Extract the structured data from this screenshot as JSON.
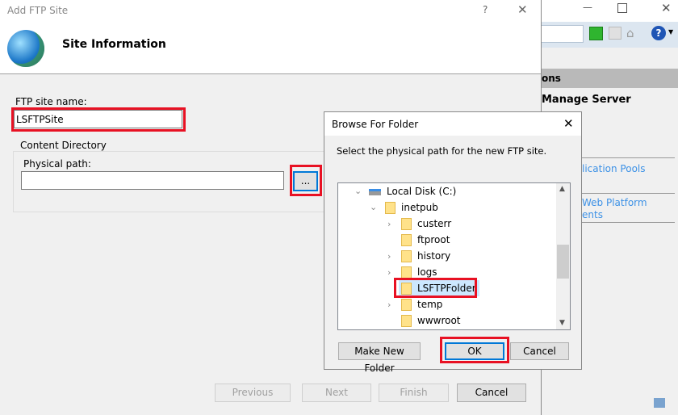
{
  "background_window": {
    "actions_header": "ons",
    "manage_server": "Manage Server",
    "link1": "lication Pools",
    "link2_line1": "Web Platform",
    "link2_line2": "ents"
  },
  "wizard": {
    "title": "Add FTP Site",
    "help": "?",
    "close": "✕",
    "heading": "Site Information",
    "site_name_label": "FTP site name:",
    "site_name_value": "LSFTPSite",
    "content_dir_label": "Content Directory",
    "physical_path_label": "Physical path:",
    "physical_path_value": "",
    "browse_label": "...",
    "buttons": {
      "previous": "Previous",
      "next": "Next",
      "finish": "Finish",
      "cancel": "Cancel"
    }
  },
  "browse": {
    "title": "Browse For Folder",
    "close": "✕",
    "instruction": "Select the physical path for the new FTP site.",
    "tree": {
      "drive": "Local Disk (C:)",
      "parent": "inetpub",
      "children": [
        "custerr",
        "ftproot",
        "history",
        "logs",
        "LSFTPFolder",
        "temp",
        "wwwroot"
      ],
      "selected": "LSFTPFolder"
    },
    "buttons": {
      "new_folder": "Make New Folder",
      "ok": "OK",
      "cancel": "Cancel"
    }
  },
  "colors": {
    "highlight": "#e81123",
    "selection": "#cce8ff",
    "link": "#3c91e6",
    "focus": "#0078d7"
  }
}
